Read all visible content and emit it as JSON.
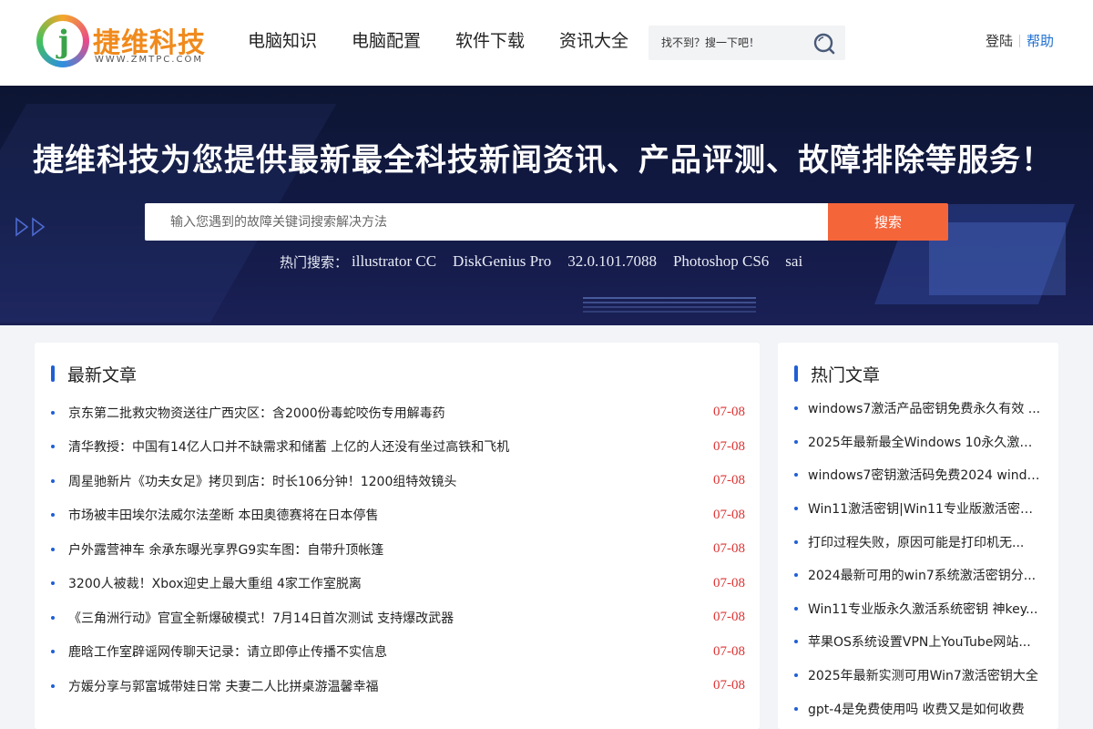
{
  "brand": {
    "name_cn": "捷维科技",
    "domain": "WWW.ZMTPC.COM"
  },
  "nav": [
    {
      "label": "电脑知识"
    },
    {
      "label": "电脑配置"
    },
    {
      "label": "软件下载"
    },
    {
      "label": "资讯大全"
    }
  ],
  "top_search": {
    "placeholder": "找不到？搜一下吧！"
  },
  "auth": {
    "login": "登陆",
    "help": "帮助"
  },
  "banner": {
    "title": "捷维科技为您提供最新最全科技新闻资讯、产品评测、故障排除等服务！",
    "search_placeholder": "输入您遇到的故障关键词搜索解决方法",
    "search_button": "搜索",
    "hot_label": "热门搜索：",
    "hot_items": [
      "illustrator CC",
      "DiskGenius Pro",
      "32.0.101.7088",
      "Photoshop CS6",
      "sai"
    ]
  },
  "latest": {
    "title": "最新文章",
    "items": [
      {
        "title": "京东第二批救灾物资送往广西灾区：含2000份毒蛇咬伤专用解毒药",
        "date": "07-08"
      },
      {
        "title": "清华教授：中国有14亿人口并不缺需求和储蓄 上亿的人还没有坐过高铁和飞机",
        "date": "07-08"
      },
      {
        "title": "周星驰新片《功夫女足》拷贝到店：时长106分钟！1200组特效镜头",
        "date": "07-08"
      },
      {
        "title": "市场被丰田埃尔法威尔法垄断 本田奥德赛将在日本停售",
        "date": "07-08"
      },
      {
        "title": "户外露营神车 余承东曝光享界G9实车图：自带升顶帐篷",
        "date": "07-08"
      },
      {
        "title": "3200人被裁！Xbox迎史上最大重组 4家工作室脱离",
        "date": "07-08"
      },
      {
        "title": "《三角洲行动》官宣全新爆破模式！7月14日首次测试 支持爆改武器",
        "date": "07-08"
      },
      {
        "title": "鹿晗工作室辟谣网传聊天记录：请立即停止传播不实信息",
        "date": "07-08"
      },
      {
        "title": "方媛分享与郭富城带娃日常 夫妻二人比拼桌游温馨幸福",
        "date": "07-08"
      }
    ]
  },
  "hot": {
    "title": "热门文章",
    "items": [
      {
        "title": "windows7激活产品密钥免费永久有效 ..."
      },
      {
        "title": "2025年最新最全Windows 10永久激活..."
      },
      {
        "title": "windows7密钥激活码免费2024 window..."
      },
      {
        "title": "Win11激活密钥|Win11专业版激活密钥..."
      },
      {
        "title": "打印过程失败，原因可能是打印机无..."
      },
      {
        "title": "2024最新可用的win7系统激活密钥分..."
      },
      {
        "title": "Win11专业版永久激活系统密钥 神key..."
      },
      {
        "title": "苹果OS系统设置VPN上YouTube网站..."
      },
      {
        "title": "2025年最新实测可用Win7激活密钥大全"
      },
      {
        "title": "gpt-4是免费使用吗 收费又是如何收费"
      }
    ]
  },
  "icons": {
    "search": "search-icon",
    "banner_arrows": "double-chevron-right-icon"
  },
  "colors": {
    "accent_blue": "#1f5fd6",
    "search_button": "#f5653a",
    "date_red": "#d33",
    "banner_bg": "#121a45",
    "brand_orange": "#f08a1c"
  }
}
